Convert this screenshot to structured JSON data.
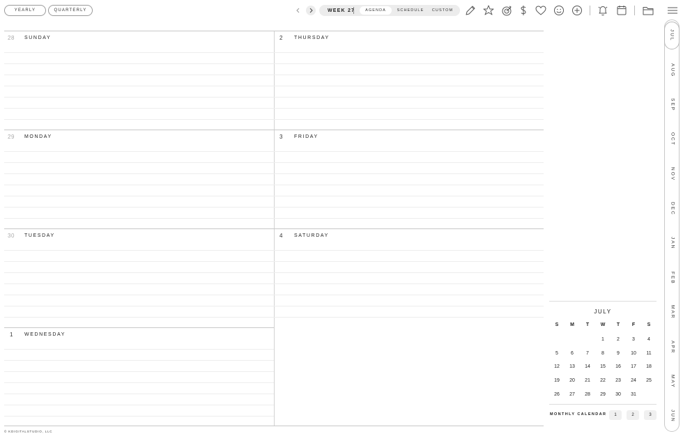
{
  "header": {
    "view_buttons": [
      "YEARLY",
      "QUARTERLY"
    ],
    "week_label": "WEEK 27",
    "tabs": [
      "AGENDA",
      "SCHEDULE",
      "CUSTOM"
    ],
    "toolbar_icons": [
      "pencil-icon",
      "pin-icon",
      "target-icon",
      "dollar-icon",
      "heart-icon",
      "smiley-icon",
      "plus-circle-icon",
      "bell-icon",
      "calendar-icon",
      "folder-icon",
      "menu-icon"
    ]
  },
  "days": [
    {
      "num": "28",
      "name": "SUNDAY"
    },
    {
      "num": "29",
      "name": "MONDAY"
    },
    {
      "num": "30",
      "name": "TUESDAY"
    },
    {
      "num": "1",
      "name": "WEDNESDAY"
    },
    {
      "num": "2",
      "name": "THURSDAY"
    },
    {
      "num": "3",
      "name": "FRIDAY"
    },
    {
      "num": "4",
      "name": "SATURDAY"
    }
  ],
  "months": [
    "JUL",
    "AUG",
    "SEP",
    "OCT",
    "NOV",
    "DEC",
    "JAN",
    "FEB",
    "MAR",
    "APR",
    "MAY",
    "JUN"
  ],
  "mini_calendar": {
    "title": "JULY",
    "weekdays": [
      "S",
      "M",
      "T",
      "W",
      "T",
      "F",
      "S"
    ],
    "weeks": [
      [
        "",
        "",
        "",
        "1",
        "2",
        "3",
        "4"
      ],
      [
        "5",
        "6",
        "7",
        "8",
        "9",
        "10",
        "11"
      ],
      [
        "12",
        "13",
        "14",
        "15",
        "16",
        "17",
        "18"
      ],
      [
        "19",
        "20",
        "21",
        "22",
        "23",
        "24",
        "25"
      ],
      [
        "26",
        "27",
        "28",
        "29",
        "30",
        "31",
        ""
      ]
    ],
    "monthly_label": "MONTHLY CALENDAR",
    "monthly_buttons": [
      "1",
      "2",
      "3"
    ]
  },
  "footer": "© KDIGITALSTUDIO, LLC"
}
